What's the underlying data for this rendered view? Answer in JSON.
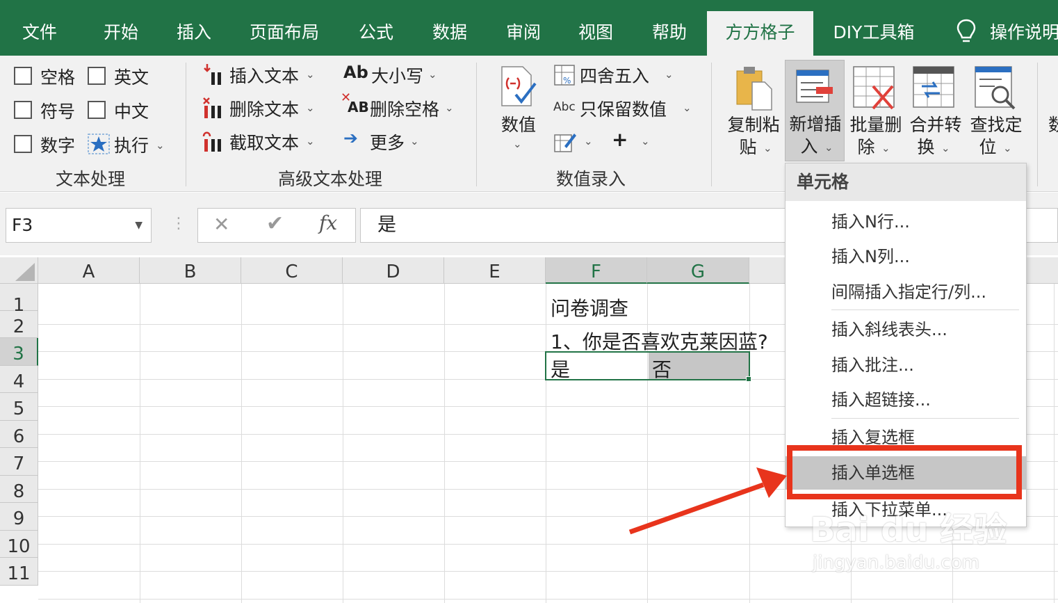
{
  "tabs": [
    {
      "label": "文件",
      "active": false
    },
    {
      "label": "开始",
      "active": false
    },
    {
      "label": "插入",
      "active": false
    },
    {
      "label": "页面布局",
      "active": false
    },
    {
      "label": "公式",
      "active": false
    },
    {
      "label": "数据",
      "active": false
    },
    {
      "label": "审阅",
      "active": false
    },
    {
      "label": "视图",
      "active": false
    },
    {
      "label": "帮助",
      "active": false
    },
    {
      "label": "方方格子",
      "active": true
    },
    {
      "label": "DIY工具箱",
      "active": false
    },
    {
      "label": "操作说明",
      "active": false
    }
  ],
  "ribbon": {
    "text_processing": {
      "checkboxes": [
        "空格",
        "英文",
        "符号",
        "中文",
        "数字"
      ],
      "execute": "执行",
      "group_label": "文本处理"
    },
    "advanced_text": {
      "insert_text": "插入文本",
      "delete_text": "删除文本",
      "extract_text": "截取文本",
      "case": "大小写",
      "case_icon_text": "Ab",
      "delete_spaces": "删除空格",
      "delete_spaces_icon_text": "AB",
      "more": "更多",
      "group_label": "高级文本处理"
    },
    "numeric_entry": {
      "numeric": "数值",
      "round": "四舍五入",
      "keep_numeric": "只保留数值",
      "keep_numeric_icon_text": "Abc",
      "plus": "+",
      "group_label": "数值录入"
    },
    "big_buttons": {
      "copy_paste": [
        "复制粘",
        "贴"
      ],
      "insert_new": [
        "新增插",
        "入"
      ],
      "batch_delete": [
        "批量删",
        "除"
      ],
      "merge_convert": [
        "合并转",
        "换"
      ],
      "find_locate": [
        "查找定",
        "位"
      ],
      "cut_off": "数"
    }
  },
  "formula_bar": {
    "name_box": "F3",
    "fx_symbol": "fx",
    "formula": "是"
  },
  "sheet": {
    "columns": [
      "A",
      "B",
      "C",
      "D",
      "E",
      "F",
      "G"
    ],
    "rows": [
      "1",
      "2",
      "3",
      "4",
      "5",
      "6",
      "7",
      "8",
      "9",
      "10",
      "11"
    ],
    "cells": {
      "F1": "问卷调查",
      "F2": "1、你是否喜欢克莱因蓝?",
      "F3": "是",
      "G3": "否"
    }
  },
  "dropdown_menu": {
    "header": "单元格",
    "items": [
      "插入N行...",
      "插入N列...",
      "间隔插入指定行/列...",
      "插入斜线表头...",
      "插入批注...",
      "插入超链接...",
      "插入复选框",
      "插入单选框",
      "插入下拉菜单..."
    ],
    "highlighted_item": "插入单选框"
  },
  "watermark": {
    "logo": "Bai du 经验",
    "url": "jingyan.baidu.com"
  },
  "colors": {
    "excel_green": "#217346",
    "highlight_red": "#e8341c",
    "ribbon_bg": "#f1f1f1"
  }
}
